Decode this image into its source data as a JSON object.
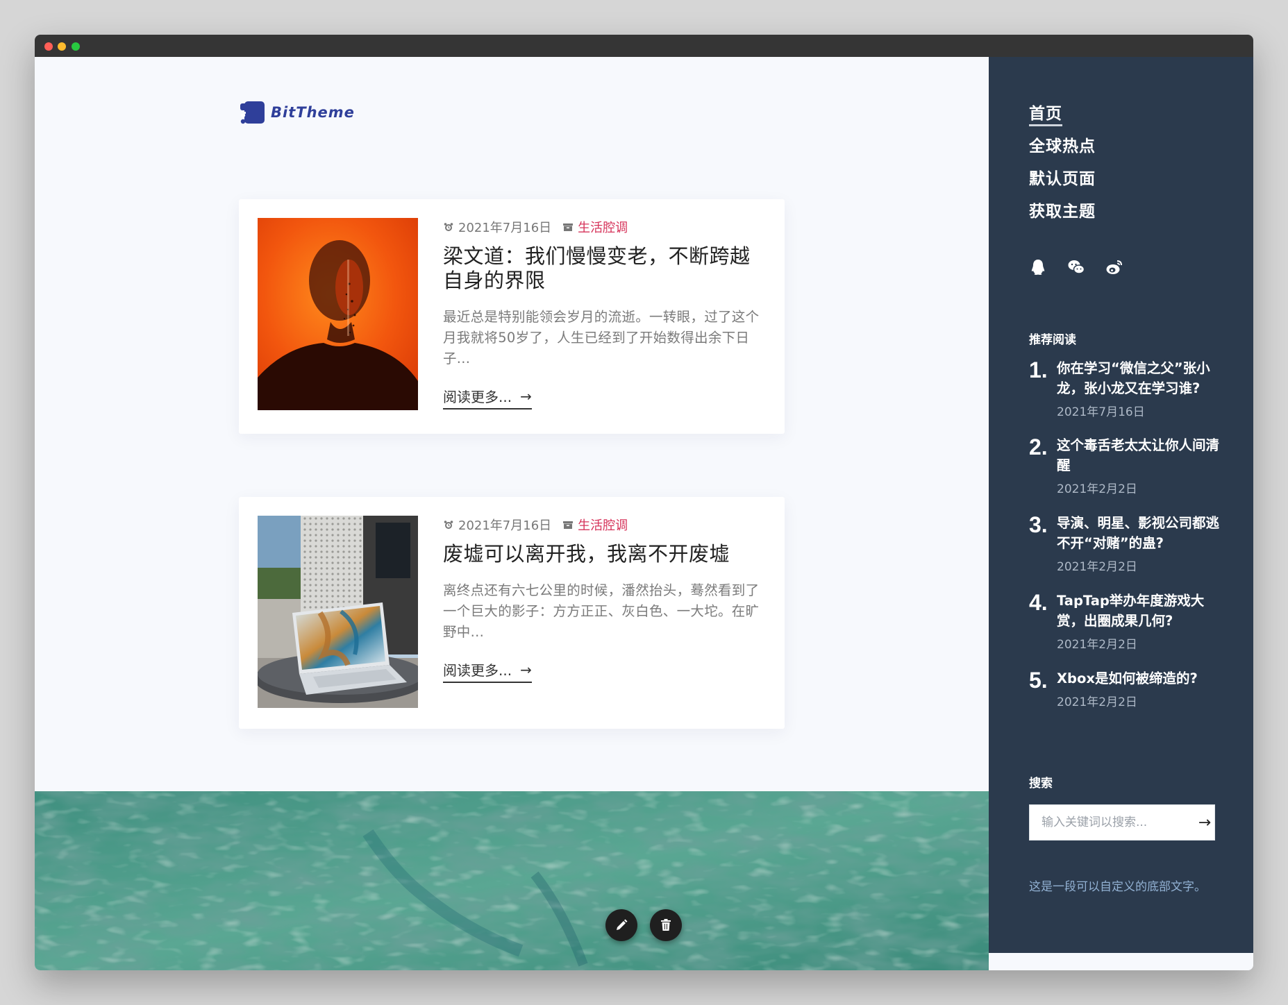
{
  "brand": {
    "name": "BitTheme"
  },
  "posts": [
    {
      "date": "2021年7月16日",
      "category": "生活腔调",
      "title": "梁文道：我们慢慢变老，不断跨越自身的界限",
      "excerpt": "最近总是特别能领会岁月的流逝。一转眼，过了这个月我就将50岁了，人生已经到了开始数得出余下日子...",
      "read_more": "阅读更多...",
      "arrow": "→"
    },
    {
      "date": "2021年7月16日",
      "category": "生活腔调",
      "title": "废墟可以离开我，我离不开废墟",
      "excerpt": "离终点还有六七公里的时候，潘然抬头，蓦然看到了一个巨大的影子：方方正正、灰白色、一大坨。在旷野中...",
      "read_more": "阅读更多...",
      "arrow": "→"
    }
  ],
  "nav": {
    "items": [
      {
        "label": "首页"
      },
      {
        "label": "全球热点"
      },
      {
        "label": "默认页面"
      },
      {
        "label": "获取主题"
      }
    ]
  },
  "socials": [
    "qq-icon",
    "wechat-icon",
    "weibo-icon"
  ],
  "recommended": {
    "title": "推荐阅读",
    "items": [
      {
        "num": "1.",
        "title": "你在学习“微信之父”张小龙，张小龙又在学习谁?",
        "date": "2021年7月16日"
      },
      {
        "num": "2.",
        "title": "这个毒舌老太太让你人间清醒",
        "date": "2021年2月2日"
      },
      {
        "num": "3.",
        "title": "导演、明星、影视公司都逃不开“对赌”的蛊?",
        "date": "2021年2月2日"
      },
      {
        "num": "4.",
        "title": "TapTap举办年度游戏大赏，出圈成果几何?",
        "date": "2021年2月2日"
      },
      {
        "num": "5.",
        "title": "Xbox是如何被缔造的?",
        "date": "2021年2月2日"
      }
    ]
  },
  "search": {
    "title": "搜索",
    "placeholder": "输入关键词以搜索...",
    "button": "→"
  },
  "footer": {
    "text": "这是一段可以自定义的底部文字。"
  },
  "colors": {
    "sidebar": "#2b3a4d",
    "category": "#d6335a",
    "brand": "#2f3f9a"
  }
}
